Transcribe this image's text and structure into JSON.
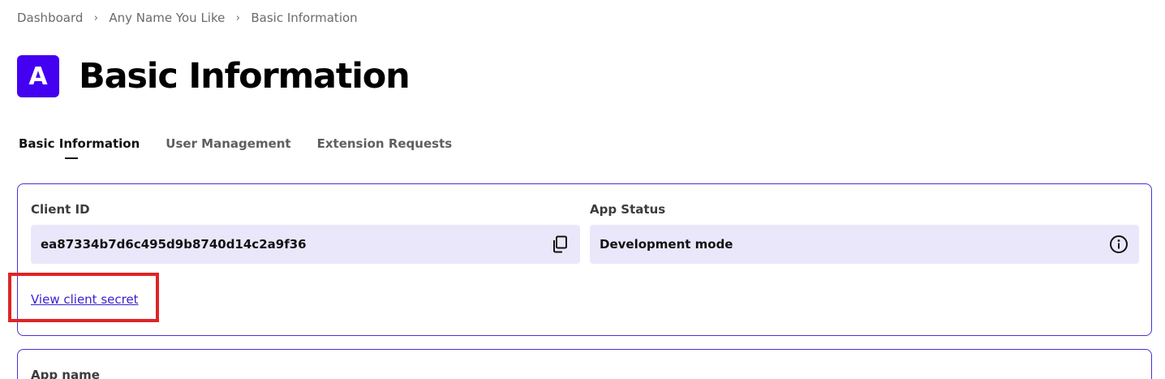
{
  "breadcrumb": {
    "items": [
      "Dashboard",
      "Any Name You Like",
      "Basic Information"
    ],
    "separator": "›"
  },
  "header": {
    "avatar_letter": "A",
    "avatar_color": "#4400f0",
    "title": "Basic Information"
  },
  "tabs": [
    {
      "label": "Basic Information",
      "active": true
    },
    {
      "label": "User Management",
      "active": false
    },
    {
      "label": "Extension Requests",
      "active": false
    }
  ],
  "credentials": {
    "client_id_label": "Client ID",
    "client_id_value": "ea87334b7d6c495d9b8740d14c2a9f36",
    "copy_icon": "copy-icon",
    "app_status_label": "App Status",
    "app_status_value": "Development mode",
    "info_icon": "info-icon",
    "view_secret_link": "View client secret"
  },
  "app_name_section": {
    "label": "App name"
  },
  "colors": {
    "accent": "#4400f0",
    "card_border": "#4a2fd4",
    "field_background": "#ebe7fb",
    "link": "#3a1fd0",
    "highlight": "#e02424"
  }
}
